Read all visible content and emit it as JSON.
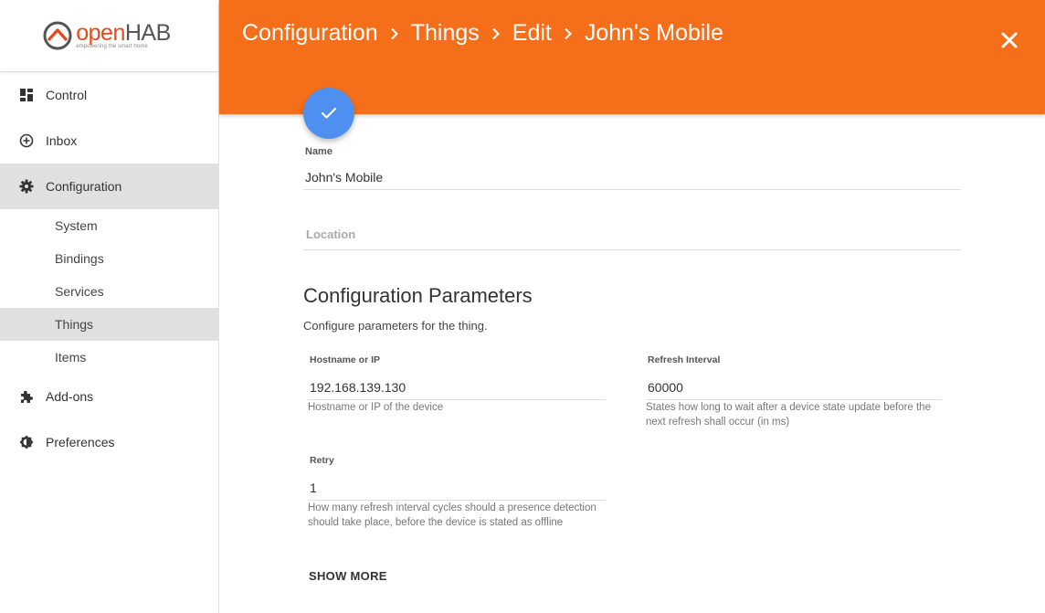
{
  "logo": {
    "brand_open": "open",
    "brand_hab": "HAB",
    "tagline": "empowering the smart home"
  },
  "sidebar": {
    "items": [
      {
        "label": "Control",
        "icon": "dashboard-icon"
      },
      {
        "label": "Inbox",
        "icon": "add-circle-icon"
      },
      {
        "label": "Configuration",
        "icon": "gear-icon"
      },
      {
        "label": "Add-ons",
        "icon": "puzzle-icon"
      },
      {
        "label": "Preferences",
        "icon": "brightness-icon"
      }
    ],
    "sub_items": [
      {
        "label": "System"
      },
      {
        "label": "Bindings"
      },
      {
        "label": "Services"
      },
      {
        "label": "Things"
      },
      {
        "label": "Items"
      }
    ]
  },
  "header": {
    "breadcrumb": [
      "Configuration",
      "Things",
      "Edit",
      "John's Mobile"
    ]
  },
  "form": {
    "name_label": "Name",
    "name_value": "John's Mobile",
    "location_placeholder": "Location"
  },
  "config": {
    "title": "Configuration Parameters",
    "description": "Configure parameters for the thing.",
    "params": [
      {
        "label": "Hostname or IP",
        "value": "192.168.139.130",
        "help": "Hostname or IP of the device"
      },
      {
        "label": "Refresh Interval",
        "value": "60000",
        "help_line1": "States how long to wait after a device state update before the",
        "help_line2": "next refresh shall occur (in ms)"
      },
      {
        "label": "Retry",
        "value": "1",
        "help_line1": "How many refresh interval cycles should a presence detection",
        "help_line2": "should take place, before the device is stated as offline"
      }
    ],
    "show_more": "SHOW MORE"
  },
  "colors": {
    "header": "#f56f1a",
    "fab": "#4f8ff0",
    "active_nav": "#e0e0e0"
  }
}
